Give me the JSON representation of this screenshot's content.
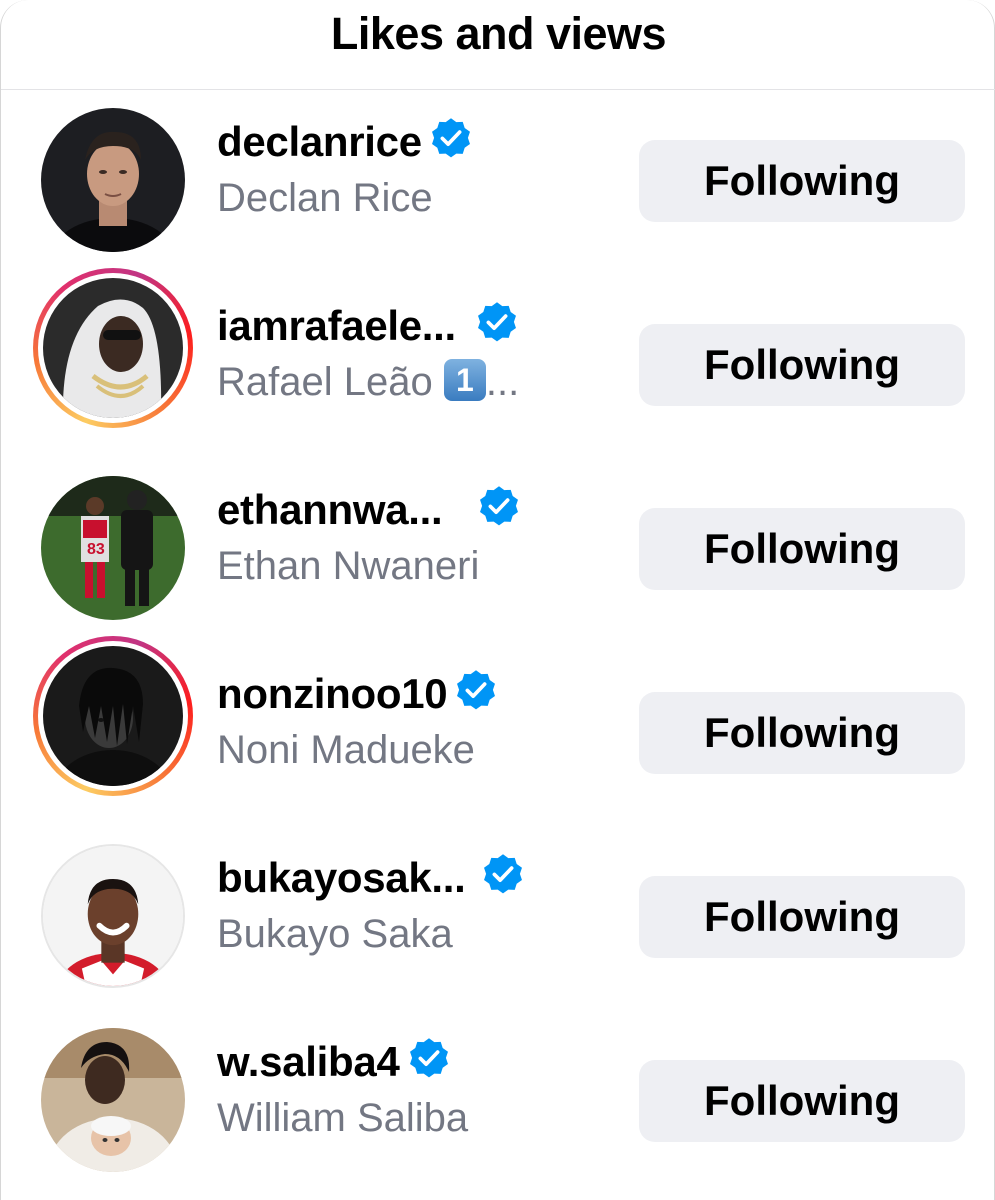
{
  "header": {
    "title": "Likes and views"
  },
  "users": [
    {
      "username": "declanrice",
      "full_name": "Declan Rice",
      "extra": "",
      "verified": true,
      "story_ring": false,
      "button": "Following"
    },
    {
      "username": "iamrafaele...",
      "full_name": "Rafael Leão",
      "extra": "1⃣...",
      "extra_digit": "1",
      "extra_ellipsis": "...",
      "verified": true,
      "story_ring": true,
      "button": "Following"
    },
    {
      "username": "ethannwa...",
      "full_name": "Ethan Nwaneri",
      "extra": "",
      "verified": true,
      "story_ring": false,
      "button": "Following"
    },
    {
      "username": "nonzinoo10",
      "full_name": "Noni Madueke",
      "extra": "",
      "verified": true,
      "story_ring": true,
      "button": "Following"
    },
    {
      "username": "bukayosak...",
      "full_name": "Bukayo Saka",
      "extra": "",
      "verified": true,
      "story_ring": false,
      "button": "Following"
    },
    {
      "username": "w.saliba4",
      "full_name": "William Saliba",
      "extra": "",
      "verified": true,
      "story_ring": false,
      "button": "Following"
    }
  ],
  "colors": {
    "verified_blue": "#0095f6",
    "button_bg": "#eeeff3",
    "secondary_text": "#737783",
    "story_ring": [
      "#fccc63",
      "#f77737",
      "#e1306c",
      "#c13584"
    ]
  }
}
